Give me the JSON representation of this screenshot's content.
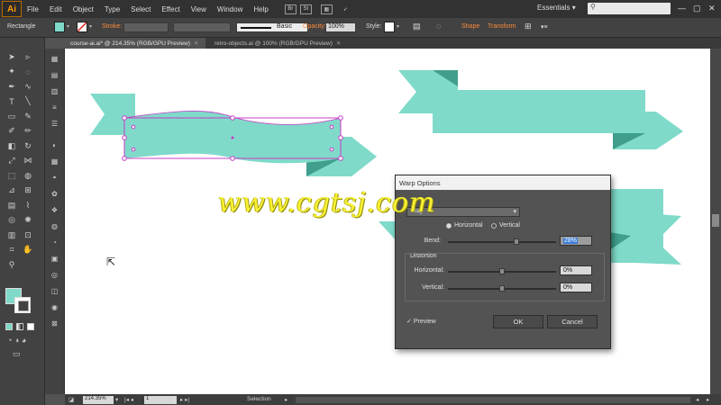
{
  "app": {
    "logo_text": "Ai"
  },
  "menu": [
    "File",
    "Edit",
    "Object",
    "Type",
    "Select",
    "Effect",
    "View",
    "Window",
    "Help"
  ],
  "menu_icons": {
    "br": "Br",
    "st": "St"
  },
  "workspace": {
    "label": "Essentials",
    "chevron": "▾"
  },
  "window_controls": {
    "minimize": "—",
    "restore": "▢",
    "close": "✕"
  },
  "control_bar": {
    "tool_name": "Rectangle",
    "stroke_label": "Stroke:",
    "brush_label": "Basic",
    "opacity_label": "Opacity:",
    "opacity_value": "100%",
    "style_label": "Style:",
    "shape_label": "Shape",
    "transform_label": "Transform",
    "fill_color": "#7ed9c8"
  },
  "tabs": [
    {
      "label": "course-ai.ai* @ 214.35% (RGB/GPU Preview)",
      "close": "✕"
    },
    {
      "label": "retro-objects.ai @ 100% (RGB/GPU Preview)",
      "close": "✕"
    }
  ],
  "tool_icons": [
    "selection-icon",
    "direct-selection-icon",
    "magic-wand-icon",
    "lasso-icon",
    "pen-icon",
    "curvature-icon",
    "type-icon",
    "line-icon",
    "rectangle-icon",
    "paintbrush-icon",
    "shaper-icon",
    "pencil-icon",
    "eraser-icon",
    "rotate-icon",
    "scale-icon",
    "width-icon",
    "free-transform-icon",
    "shape-builder-icon",
    "perspective-icon",
    "mesh-icon",
    "gradient-icon",
    "eyedropper-icon",
    "blend-icon",
    "symbol-sprayer-icon",
    "graph-icon",
    "artboard-icon",
    "slice-icon",
    "hand-icon",
    "zoom-icon"
  ],
  "colors": {
    "ribbon_light": "#7fdac9",
    "ribbon_dark": "#5cbfad",
    "ribbon_shadow": "#3f9e8c",
    "selection": "#c83cc8",
    "watermark": "#f7f035"
  },
  "dialog": {
    "title": "Warp Options",
    "style_value": "Flag",
    "horizontal_label": "Horizontal",
    "vertical_label": "Vertical",
    "bend_label": "Bend:",
    "bend_value": "28%",
    "bend_level": 0.64,
    "distortion_label": "Distortion",
    "dist_horizontal_label": "Horizontal:",
    "dist_horizontal_value": "0%",
    "dist_vertical_label": "Vertical:",
    "dist_vertical_value": "0%",
    "preview_label": "Preview",
    "ok_label": "OK",
    "cancel_label": "Cancel"
  },
  "status_bar": {
    "zoom": "214.35%",
    "page": "1",
    "tool": "Selection"
  },
  "watermark": "www.cgtsj.com"
}
